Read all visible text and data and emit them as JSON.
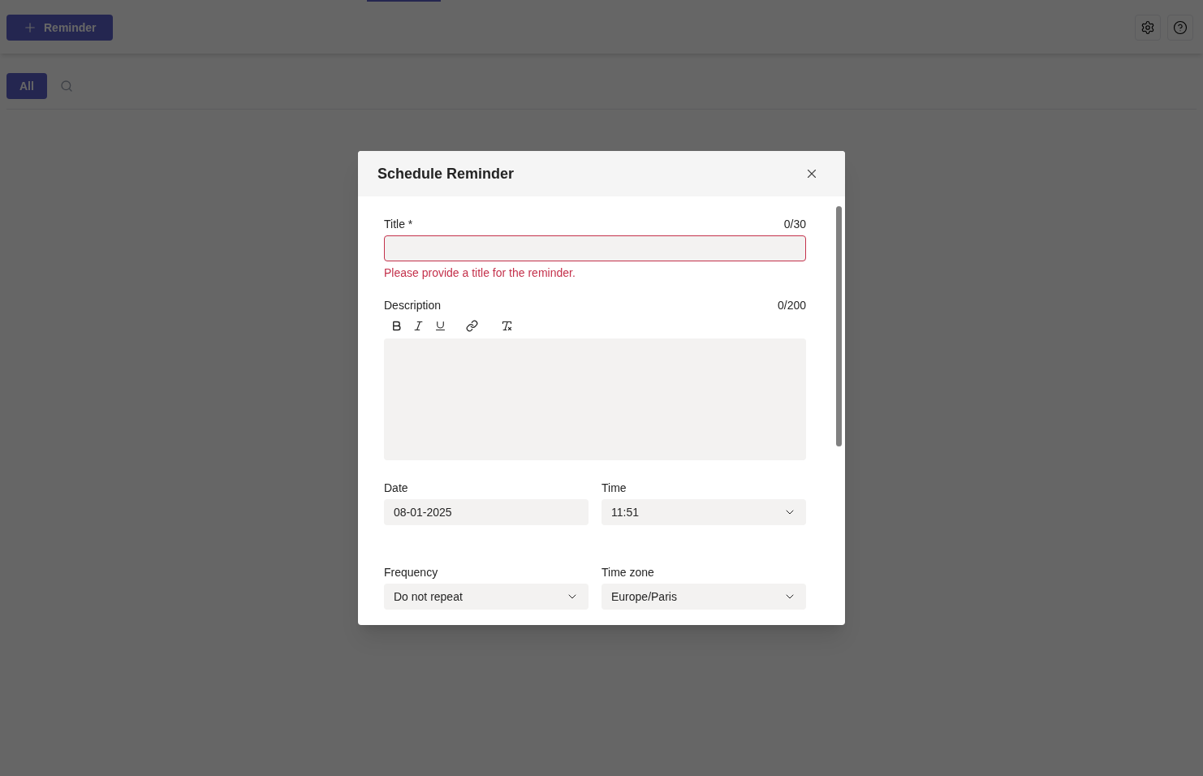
{
  "header": {
    "new_button": "Reminder"
  },
  "filters": [
    {
      "label": "All",
      "selected": true
    }
  ],
  "dialog": {
    "title": "Schedule Reminder",
    "title_field": {
      "label": "Title *",
      "counter": "0/30",
      "invalid": true,
      "error": "Please provide a title for the reminder."
    },
    "description": {
      "label": "Description",
      "counter": "0/200"
    },
    "date": {
      "label": "Date",
      "value": "08-01-2025"
    },
    "time": {
      "label": "Time",
      "value": "11:51"
    },
    "frequency": {
      "label": "Frequency",
      "value": "Do not repeat"
    },
    "time_zone": {
      "label": "Time zone",
      "value": "Europe/Paris"
    }
  }
}
